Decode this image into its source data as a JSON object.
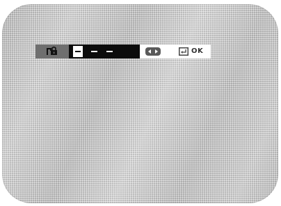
{
  "osd": {
    "mode_icon": "lock-icon",
    "pin": {
      "digits": [
        "-",
        "-",
        "-"
      ],
      "active_index": 0
    },
    "controls": {
      "left_right_icon": "left-right-arrows-icon",
      "ok_icon": "enter-key-icon",
      "ok_label": "OK"
    }
  },
  "colors": {
    "screen": "#bdbdbd",
    "icon_segment": "#6f6f6f",
    "pin_segment": "#0c0c0c",
    "controls_segment": "#ffffff"
  }
}
